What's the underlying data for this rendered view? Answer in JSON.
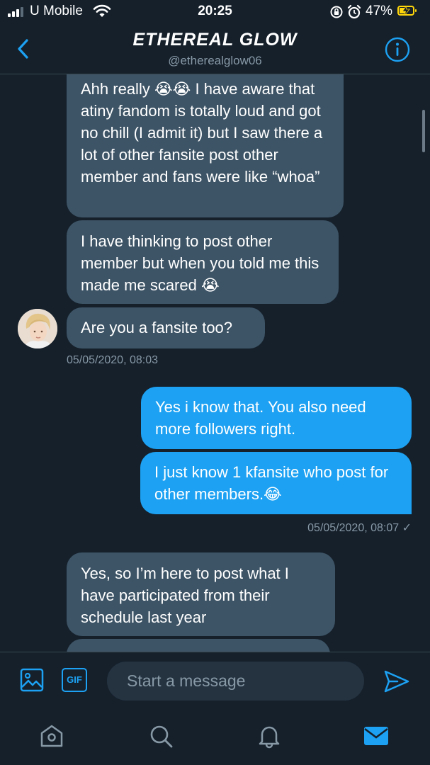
{
  "status": {
    "carrier": "U Mobile",
    "time": "20:25",
    "battery_pct": "47%"
  },
  "header": {
    "title": "ETHEREAL GLOW",
    "handle": "@etherealglow06"
  },
  "messages": [
    {
      "from": "them",
      "text": "Ahh really 😭😭 I have aware that atiny fandom is totally loud and got no chill (I admit it) but I saw there a lot of other fansite post other member and fans were like “whoa”"
    },
    {
      "from": "them",
      "text": "I have thinking to post other member but when you told me this made me scared 😭"
    },
    {
      "from": "them",
      "text": "Are you a fansite too?"
    },
    {
      "from": "me",
      "text": "Yes i know that. You also need more followers right."
    },
    {
      "from": "me",
      "text": "I just know 1 kfansite who post for other members.😂"
    },
    {
      "from": "them",
      "text": "Yes, so I’m here to post what I have participated from their schedule last year"
    }
  ],
  "timestamps": {
    "them_1": "05/05/2020, 08:03",
    "me_1": "05/05/2020, 08:07 ✓"
  },
  "composer": {
    "gif_label": "GIF",
    "placeholder": "Start a message"
  },
  "icons": {
    "back": "chevron-left-icon",
    "info": "info-icon",
    "image": "image-icon",
    "send": "send-icon",
    "home": "home-icon",
    "search": "search-icon",
    "notifications": "bell-icon",
    "messages": "mail-icon"
  },
  "colors": {
    "background": "#15202b",
    "accent": "#1da1f2",
    "incoming_bubble": "#3d5466",
    "muted_text": "#8899a6"
  }
}
